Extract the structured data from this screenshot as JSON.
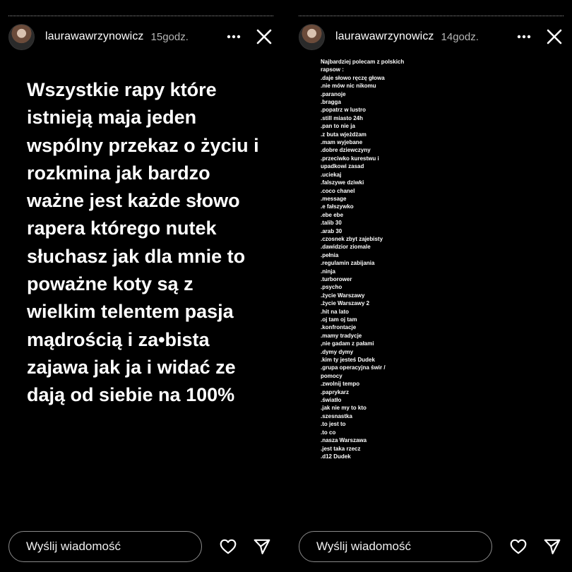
{
  "left_story": {
    "username": "laurawawrzynowicz",
    "time": "15godz.",
    "text": "Wszystkie rapy które istnieją maja jeden wspólny przekaz o życiu i rozkmina jak bardzo ważne jest każde słowo rapera którego nutek słuchasz jak dla mnie to poważne koty są z wielkim telentem pasja mądrością i za•bista zajawa jak ja i widać ze dają od siebie na 100%",
    "message_placeholder": "Wyślij wiadomość"
  },
  "right_story": {
    "username": "laurawawrzynowicz",
    "time": "14godz.",
    "intro": "Najbardziej polecam z polskich rapsow :",
    "items": [
      ".daje słowo ręczę głowa",
      ".nie mów nic nikomu",
      ".paranoje",
      ".bragga",
      ".popatrz w lustro",
      ".still miasto 24h",
      ".pan to nie ja",
      ".z buta wjeżdżam",
      ".mam wyjebane",
      ".dobre dziewczyny",
      ".przeciwko kurestwu i upadkowi zasad",
      ".uciekaj",
      ".falszywe dziwki",
      ".coco chanel",
      ".message",
      ".e fałszywko",
      ".ebe ebe",
      ".talib 30",
      ".arab 30",
      ".czosnek zbyt zajebisty",
      ".dawidzior ziomale",
      ".pełnia",
      ".regulamin zabijania",
      ".ninja",
      ".turborower",
      ".psycho",
      ".życie Warszawy",
      ".życie Warszawy 2",
      ".hit na lato",
      ".oj tam oj tam",
      ".konfrontacje",
      ".mamy tradycje",
      ",nie gadam z pałami",
      ".dymy dymy",
      ".kim ty jesteś Dudek",
      ".grupa operacyjna świr / pomocy",
      ".zwolnij tempo",
      ".paprykarz",
      ".światło",
      ".jak nie my to kto",
      ".szesnastka",
      ".to jest to",
      ".to co",
      ".nasza Warszawa",
      ".jest taka rzecz",
      ".d12 Dudek"
    ],
    "message_placeholder": "Wyślij wiadomość"
  },
  "icons": {
    "more": "more-horizontal-icon",
    "close": "close-icon",
    "like": "heart-icon",
    "share": "send-icon"
  }
}
